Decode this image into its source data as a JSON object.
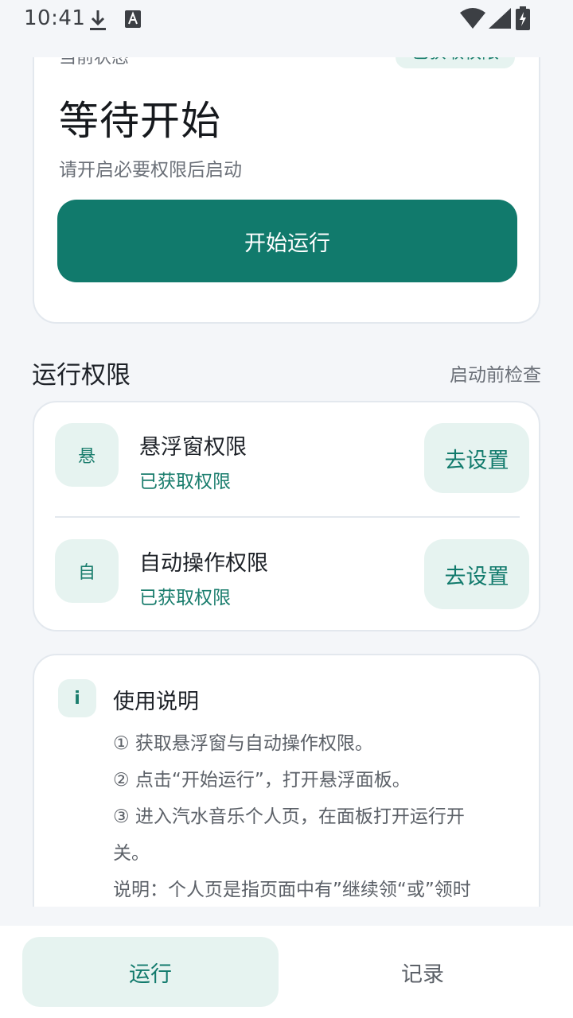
{
  "status_bar": {
    "time": "10:41"
  },
  "status_card": {
    "label": "当前状态",
    "chip": "已获取权限",
    "title": "等待开始",
    "subtitle": "请开启必要权限后启动",
    "start_button": "开始运行"
  },
  "permissions": {
    "section_title": "运行权限",
    "section_action": "启动前检查",
    "items": [
      {
        "badge": "悬",
        "name": "悬浮窗权限",
        "state": "已获取权限",
        "button": "去设置"
      },
      {
        "badge": "自",
        "name": "自动操作权限",
        "state": "已获取权限",
        "button": "去设置"
      }
    ]
  },
  "help": {
    "badge": "i",
    "title": "使用说明",
    "lines": [
      "① 获取悬浮窗与自动操作权限。",
      "② 点击“开始运行”，打开悬浮面板。",
      "③ 进入汽水音乐个人页，在面板打开运行开",
      "关。",
      "说明：个人页是指页面中有”继续领“或”领时长”"
    ]
  },
  "nav": {
    "run": "运行",
    "log": "记录"
  },
  "colors": {
    "accent": "#117a6c",
    "accent_soft": "#e6f3f0",
    "background": "#f4f6f9"
  }
}
